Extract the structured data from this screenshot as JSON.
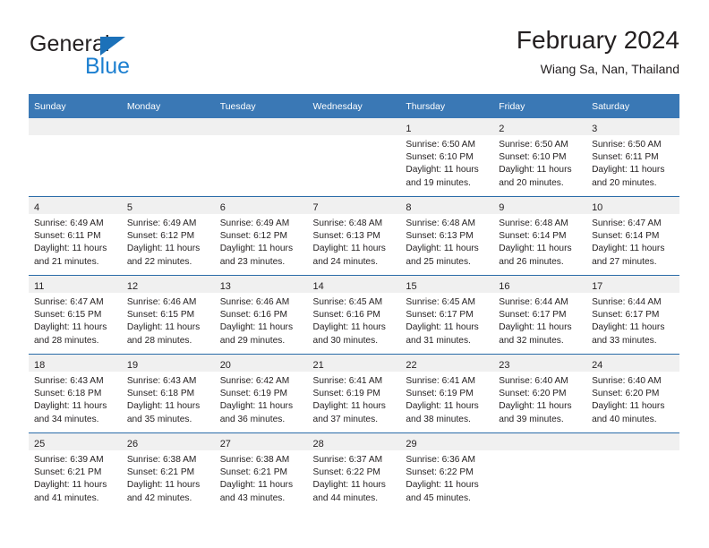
{
  "brand": {
    "name_part1": "General",
    "name_part2": "Blue",
    "triangle_color": "#1c71b9",
    "blue_text_color": "#1c7fd0",
    "logo_icon": "triangle-flag-icon"
  },
  "header": {
    "title": "February 2024",
    "subtitle": "Wiang Sa, Nan, Thailand"
  },
  "theme": {
    "header_bg": "#3a78b5",
    "row_divider": "#2a6ca8",
    "daynum_band_bg": "#f0f0f0",
    "text": "#231f20"
  },
  "weekdays": [
    "Sunday",
    "Monday",
    "Tuesday",
    "Wednesday",
    "Thursday",
    "Friday",
    "Saturday"
  ],
  "weeks": [
    [
      {
        "day": "",
        "sunrise": "",
        "sunset": "",
        "daylight1": "",
        "daylight2": ""
      },
      {
        "day": "",
        "sunrise": "",
        "sunset": "",
        "daylight1": "",
        "daylight2": ""
      },
      {
        "day": "",
        "sunrise": "",
        "sunset": "",
        "daylight1": "",
        "daylight2": ""
      },
      {
        "day": "",
        "sunrise": "",
        "sunset": "",
        "daylight1": "",
        "daylight2": ""
      },
      {
        "day": "1",
        "sunrise": "Sunrise: 6:50 AM",
        "sunset": "Sunset: 6:10 PM",
        "daylight1": "Daylight: 11 hours",
        "daylight2": "and 19 minutes."
      },
      {
        "day": "2",
        "sunrise": "Sunrise: 6:50 AM",
        "sunset": "Sunset: 6:10 PM",
        "daylight1": "Daylight: 11 hours",
        "daylight2": "and 20 minutes."
      },
      {
        "day": "3",
        "sunrise": "Sunrise: 6:50 AM",
        "sunset": "Sunset: 6:11 PM",
        "daylight1": "Daylight: 11 hours",
        "daylight2": "and 20 minutes."
      }
    ],
    [
      {
        "day": "4",
        "sunrise": "Sunrise: 6:49 AM",
        "sunset": "Sunset: 6:11 PM",
        "daylight1": "Daylight: 11 hours",
        "daylight2": "and 21 minutes."
      },
      {
        "day": "5",
        "sunrise": "Sunrise: 6:49 AM",
        "sunset": "Sunset: 6:12 PM",
        "daylight1": "Daylight: 11 hours",
        "daylight2": "and 22 minutes."
      },
      {
        "day": "6",
        "sunrise": "Sunrise: 6:49 AM",
        "sunset": "Sunset: 6:12 PM",
        "daylight1": "Daylight: 11 hours",
        "daylight2": "and 23 minutes."
      },
      {
        "day": "7",
        "sunrise": "Sunrise: 6:48 AM",
        "sunset": "Sunset: 6:13 PM",
        "daylight1": "Daylight: 11 hours",
        "daylight2": "and 24 minutes."
      },
      {
        "day": "8",
        "sunrise": "Sunrise: 6:48 AM",
        "sunset": "Sunset: 6:13 PM",
        "daylight1": "Daylight: 11 hours",
        "daylight2": "and 25 minutes."
      },
      {
        "day": "9",
        "sunrise": "Sunrise: 6:48 AM",
        "sunset": "Sunset: 6:14 PM",
        "daylight1": "Daylight: 11 hours",
        "daylight2": "and 26 minutes."
      },
      {
        "day": "10",
        "sunrise": "Sunrise: 6:47 AM",
        "sunset": "Sunset: 6:14 PM",
        "daylight1": "Daylight: 11 hours",
        "daylight2": "and 27 minutes."
      }
    ],
    [
      {
        "day": "11",
        "sunrise": "Sunrise: 6:47 AM",
        "sunset": "Sunset: 6:15 PM",
        "daylight1": "Daylight: 11 hours",
        "daylight2": "and 28 minutes."
      },
      {
        "day": "12",
        "sunrise": "Sunrise: 6:46 AM",
        "sunset": "Sunset: 6:15 PM",
        "daylight1": "Daylight: 11 hours",
        "daylight2": "and 28 minutes."
      },
      {
        "day": "13",
        "sunrise": "Sunrise: 6:46 AM",
        "sunset": "Sunset: 6:16 PM",
        "daylight1": "Daylight: 11 hours",
        "daylight2": "and 29 minutes."
      },
      {
        "day": "14",
        "sunrise": "Sunrise: 6:45 AM",
        "sunset": "Sunset: 6:16 PM",
        "daylight1": "Daylight: 11 hours",
        "daylight2": "and 30 minutes."
      },
      {
        "day": "15",
        "sunrise": "Sunrise: 6:45 AM",
        "sunset": "Sunset: 6:17 PM",
        "daylight1": "Daylight: 11 hours",
        "daylight2": "and 31 minutes."
      },
      {
        "day": "16",
        "sunrise": "Sunrise: 6:44 AM",
        "sunset": "Sunset: 6:17 PM",
        "daylight1": "Daylight: 11 hours",
        "daylight2": "and 32 minutes."
      },
      {
        "day": "17",
        "sunrise": "Sunrise: 6:44 AM",
        "sunset": "Sunset: 6:17 PM",
        "daylight1": "Daylight: 11 hours",
        "daylight2": "and 33 minutes."
      }
    ],
    [
      {
        "day": "18",
        "sunrise": "Sunrise: 6:43 AM",
        "sunset": "Sunset: 6:18 PM",
        "daylight1": "Daylight: 11 hours",
        "daylight2": "and 34 minutes."
      },
      {
        "day": "19",
        "sunrise": "Sunrise: 6:43 AM",
        "sunset": "Sunset: 6:18 PM",
        "daylight1": "Daylight: 11 hours",
        "daylight2": "and 35 minutes."
      },
      {
        "day": "20",
        "sunrise": "Sunrise: 6:42 AM",
        "sunset": "Sunset: 6:19 PM",
        "daylight1": "Daylight: 11 hours",
        "daylight2": "and 36 minutes."
      },
      {
        "day": "21",
        "sunrise": "Sunrise: 6:41 AM",
        "sunset": "Sunset: 6:19 PM",
        "daylight1": "Daylight: 11 hours",
        "daylight2": "and 37 minutes."
      },
      {
        "day": "22",
        "sunrise": "Sunrise: 6:41 AM",
        "sunset": "Sunset: 6:19 PM",
        "daylight1": "Daylight: 11 hours",
        "daylight2": "and 38 minutes."
      },
      {
        "day": "23",
        "sunrise": "Sunrise: 6:40 AM",
        "sunset": "Sunset: 6:20 PM",
        "daylight1": "Daylight: 11 hours",
        "daylight2": "and 39 minutes."
      },
      {
        "day": "24",
        "sunrise": "Sunrise: 6:40 AM",
        "sunset": "Sunset: 6:20 PM",
        "daylight1": "Daylight: 11 hours",
        "daylight2": "and 40 minutes."
      }
    ],
    [
      {
        "day": "25",
        "sunrise": "Sunrise: 6:39 AM",
        "sunset": "Sunset: 6:21 PM",
        "daylight1": "Daylight: 11 hours",
        "daylight2": "and 41 minutes."
      },
      {
        "day": "26",
        "sunrise": "Sunrise: 6:38 AM",
        "sunset": "Sunset: 6:21 PM",
        "daylight1": "Daylight: 11 hours",
        "daylight2": "and 42 minutes."
      },
      {
        "day": "27",
        "sunrise": "Sunrise: 6:38 AM",
        "sunset": "Sunset: 6:21 PM",
        "daylight1": "Daylight: 11 hours",
        "daylight2": "and 43 minutes."
      },
      {
        "day": "28",
        "sunrise": "Sunrise: 6:37 AM",
        "sunset": "Sunset: 6:22 PM",
        "daylight1": "Daylight: 11 hours",
        "daylight2": "and 44 minutes."
      },
      {
        "day": "29",
        "sunrise": "Sunrise: 6:36 AM",
        "sunset": "Sunset: 6:22 PM",
        "daylight1": "Daylight: 11 hours",
        "daylight2": "and 45 minutes."
      },
      {
        "day": "",
        "sunrise": "",
        "sunset": "",
        "daylight1": "",
        "daylight2": ""
      },
      {
        "day": "",
        "sunrise": "",
        "sunset": "",
        "daylight1": "",
        "daylight2": ""
      }
    ]
  ]
}
